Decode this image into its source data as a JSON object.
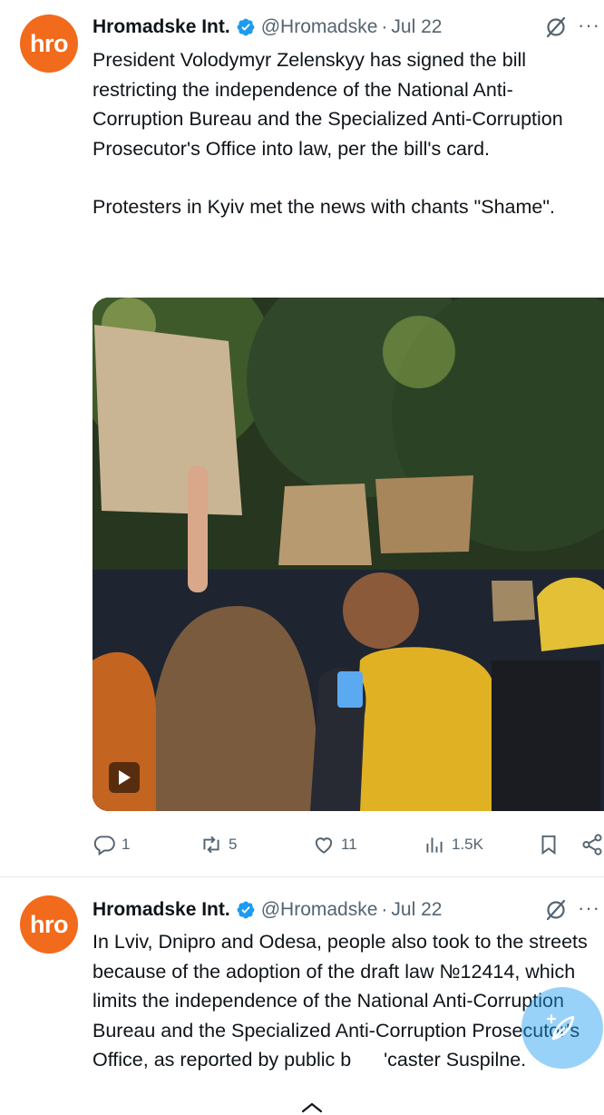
{
  "tweets": [
    {
      "avatar_text": "hro",
      "display_name": "Hromadske Int.",
      "handle": "@Hromadske",
      "separator": "·",
      "date": "Jul 22",
      "text_paragraphs": [
        "President Volodymyr Zelenskyy has signed the bill restricting the independence of the National Anti-Corruption Bureau and the Specialized Anti-Corruption Prosecutor's Office into law, per the bill's card.",
        "Protesters in Kyiv met the news with chants \"Shame\"."
      ],
      "media_type": "video",
      "stats": {
        "replies": "1",
        "reposts": "5",
        "likes": "11",
        "views": "1.5K"
      }
    },
    {
      "avatar_text": "hro",
      "display_name": "Hromadske Int.",
      "handle": "@Hromadske",
      "separator": "·",
      "date": "Jul 22",
      "text_paragraphs": [
        "In Lviv, Dnipro and Odesa, people also took to the streets because of the adoption of the draft law №12414, which limits the independence of the National Anti-Corruption Bureau and the Specialized Anti-Corruption Prosecutor's Office, as reported by public b      'caster Suspilne."
      ]
    }
  ],
  "icons": {
    "verified": "verified-badge-icon",
    "grok": "grok-icon",
    "more": "more-icon",
    "reply": "reply-icon",
    "repost": "repost-icon",
    "like": "like-icon",
    "views": "views-icon",
    "bookmark": "bookmark-icon",
    "share": "share-icon",
    "compose": "compose-post-icon",
    "play": "play-icon"
  },
  "colors": {
    "avatar_bg": "#f26a1b",
    "verified": "#1d9bf0",
    "secondary_text": "#536471",
    "fab": "#1d9bf0"
  }
}
